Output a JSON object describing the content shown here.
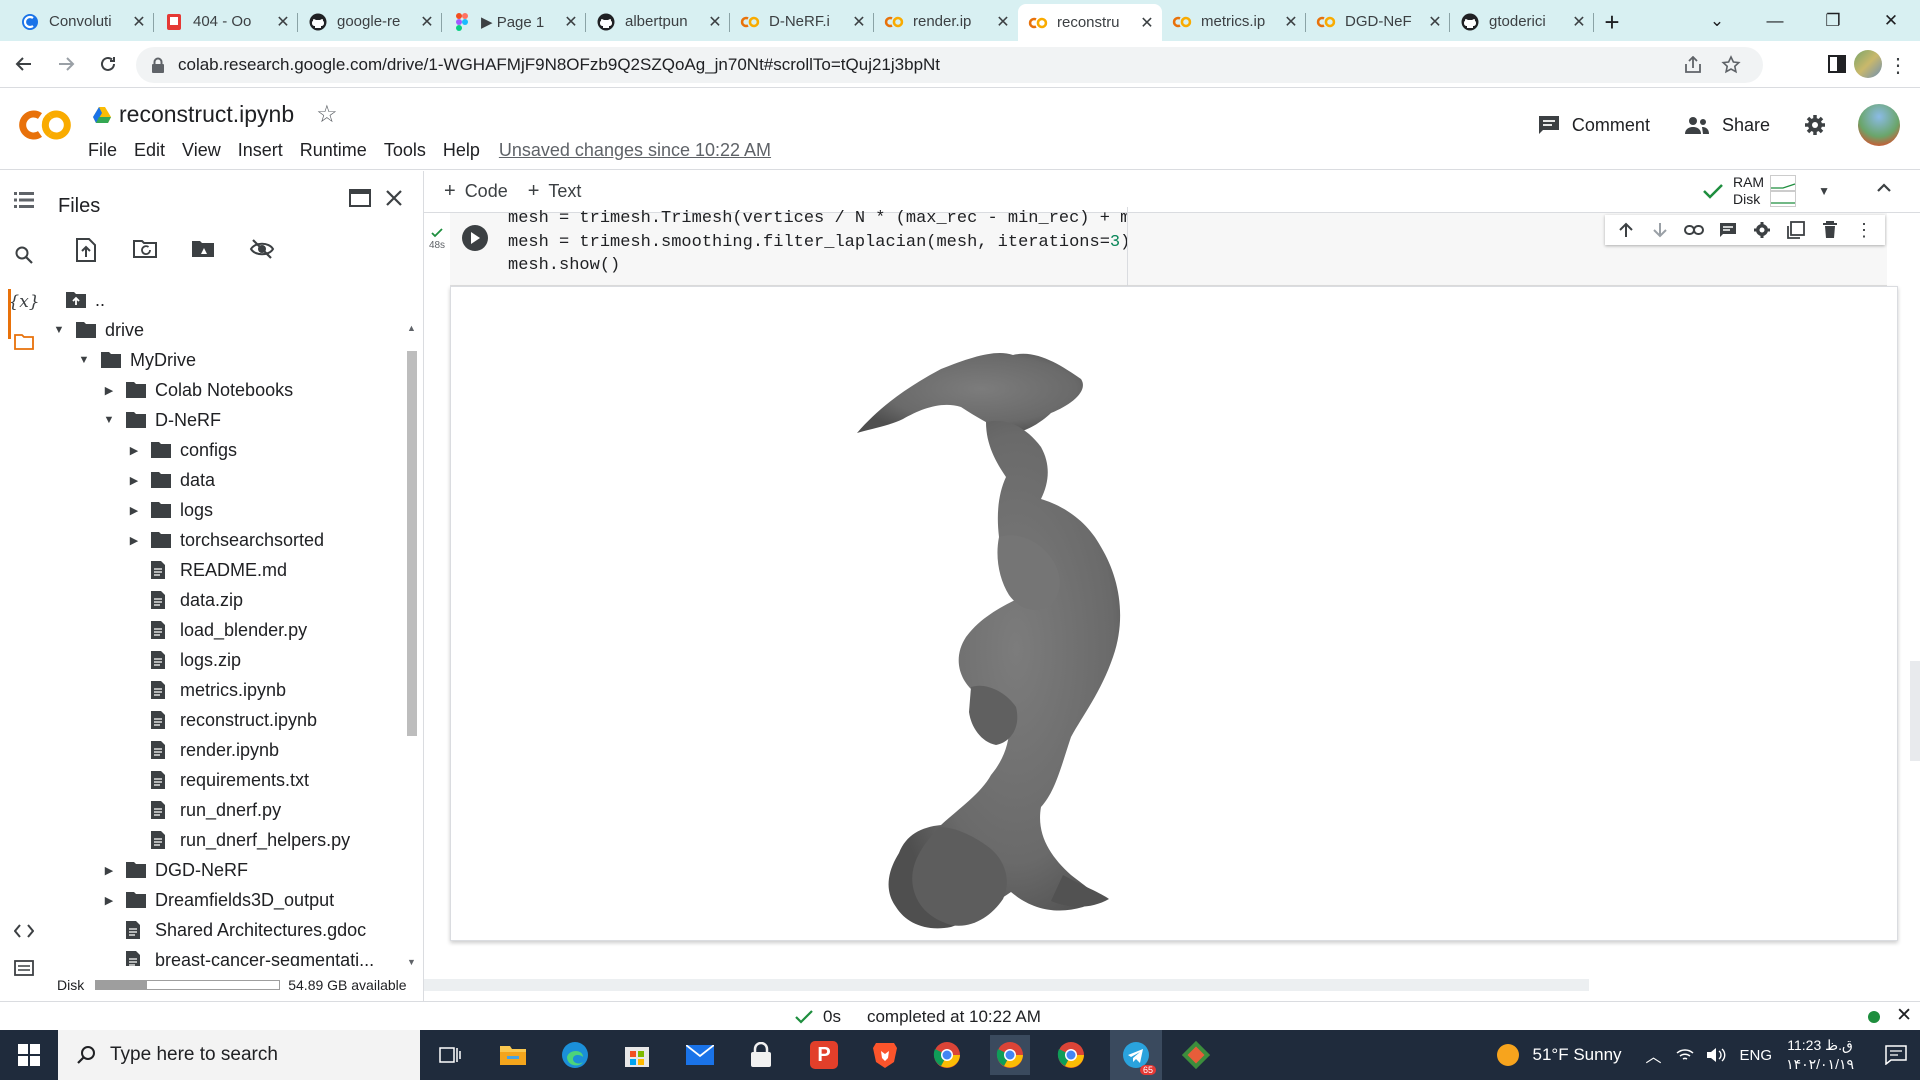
{
  "browser": {
    "tabs": [
      {
        "title": "Convoluti",
        "icon": "colab-red-icon",
        "active": false
      },
      {
        "title": "404 - Oo",
        "icon": "red-shield-icon",
        "active": false
      },
      {
        "title": "google-re",
        "icon": "github-icon",
        "active": false
      },
      {
        "title": "▶ Page 1",
        "icon": "figma-icon",
        "active": false
      },
      {
        "title": "albertpun",
        "icon": "github-icon",
        "active": false
      },
      {
        "title": "D-NeRF.i",
        "icon": "colab-icon",
        "active": false
      },
      {
        "title": "render.ip",
        "icon": "colab-icon",
        "active": false
      },
      {
        "title": "reconstru",
        "icon": "colab-icon",
        "active": true
      },
      {
        "title": "metrics.ip",
        "icon": "colab-icon",
        "active": false
      },
      {
        "title": "DGD-NeF",
        "icon": "colab-icon",
        "active": false
      },
      {
        "title": "gtoderici",
        "icon": "github-icon",
        "active": false
      }
    ],
    "new_tab": "+",
    "url": "colab.research.google.com/drive/1-WGHAFMjF9N8OFzb9Q2SZQoAg_jn70Nt#scrollTo=tQuj21j3bpNt"
  },
  "colab": {
    "doc_name": "reconstruct.ipynb",
    "menu": [
      "File",
      "Edit",
      "View",
      "Insert",
      "Runtime",
      "Tools",
      "Help"
    ],
    "unsaved": "Unsaved changes since 10:22 AM",
    "comment_label": "Comment",
    "share_label": "Share"
  },
  "files_panel": {
    "title": "Files",
    "tree": [
      {
        "label": "..",
        "indent": 0,
        "type": "up",
        "arrow": ""
      },
      {
        "label": "drive",
        "indent": 0,
        "type": "folder",
        "arrow": "▼"
      },
      {
        "label": "MyDrive",
        "indent": 1,
        "type": "folder",
        "arrow": "▼"
      },
      {
        "label": "Colab Notebooks",
        "indent": 2,
        "type": "folder",
        "arrow": "▶"
      },
      {
        "label": "D-NeRF",
        "indent": 2,
        "type": "folder",
        "arrow": "▼"
      },
      {
        "label": "configs",
        "indent": 3,
        "type": "folder",
        "arrow": "▶"
      },
      {
        "label": "data",
        "indent": 3,
        "type": "folder",
        "arrow": "▶"
      },
      {
        "label": "logs",
        "indent": 3,
        "type": "folder",
        "arrow": "▶"
      },
      {
        "label": "torchsearchsorted",
        "indent": 3,
        "type": "folder",
        "arrow": "▶"
      },
      {
        "label": "README.md",
        "indent": 3,
        "type": "file",
        "arrow": ""
      },
      {
        "label": "data.zip",
        "indent": 3,
        "type": "file",
        "arrow": ""
      },
      {
        "label": "load_blender.py",
        "indent": 3,
        "type": "file",
        "arrow": ""
      },
      {
        "label": "logs.zip",
        "indent": 3,
        "type": "file",
        "arrow": ""
      },
      {
        "label": "metrics.ipynb",
        "indent": 3,
        "type": "file",
        "arrow": ""
      },
      {
        "label": "reconstruct.ipynb",
        "indent": 3,
        "type": "file",
        "arrow": ""
      },
      {
        "label": "render.ipynb",
        "indent": 3,
        "type": "file",
        "arrow": ""
      },
      {
        "label": "requirements.txt",
        "indent": 3,
        "type": "file",
        "arrow": ""
      },
      {
        "label": "run_dnerf.py",
        "indent": 3,
        "type": "file",
        "arrow": ""
      },
      {
        "label": "run_dnerf_helpers.py",
        "indent": 3,
        "type": "file",
        "arrow": ""
      },
      {
        "label": "DGD-NeRF",
        "indent": 2,
        "type": "folder",
        "arrow": "▶"
      },
      {
        "label": "Dreamfields3D_output",
        "indent": 2,
        "type": "folder",
        "arrow": "▶"
      },
      {
        "label": "Shared Architectures.gdoc",
        "indent": 2,
        "type": "file",
        "arrow": ""
      },
      {
        "label": "breast-cancer-segmentati...",
        "indent": 2,
        "type": "file",
        "arrow": ""
      }
    ],
    "disk_label": "Disk",
    "disk_available": "54.89 GB available",
    "disk_used_fraction": 0.28
  },
  "notebook": {
    "add_code": "Code",
    "add_text": "Text",
    "ram_label": "RAM",
    "disk_label": "Disk",
    "cell_exec_time": "48s",
    "code_lines": [
      "mesh = trimesh.Trimesh(vertices / N * (max_rec - min_rec) + min_rec , triangles)",
      "mesh = trimesh.smoothing.filter_laplacian(mesh, iterations=3)",
      "mesh.show()"
    ],
    "number_color": "#098658"
  },
  "status": {
    "duration": "0s",
    "completed": "completed at 10:22 AM"
  },
  "taskbar": {
    "search_placeholder": "Type here to search",
    "weather": "51°F  Sunny",
    "language": "ENG",
    "time": "11:23 ق.ظ",
    "date": "۱۴۰۲/۰۱/۱۹",
    "telegram_badge": "65"
  },
  "colors": {
    "tabstrip": "#d8f0f2",
    "colab_orange": "#f9ab00",
    "taskbar": "#1f2b3c",
    "mesh_gray": "#6f6f6f"
  }
}
